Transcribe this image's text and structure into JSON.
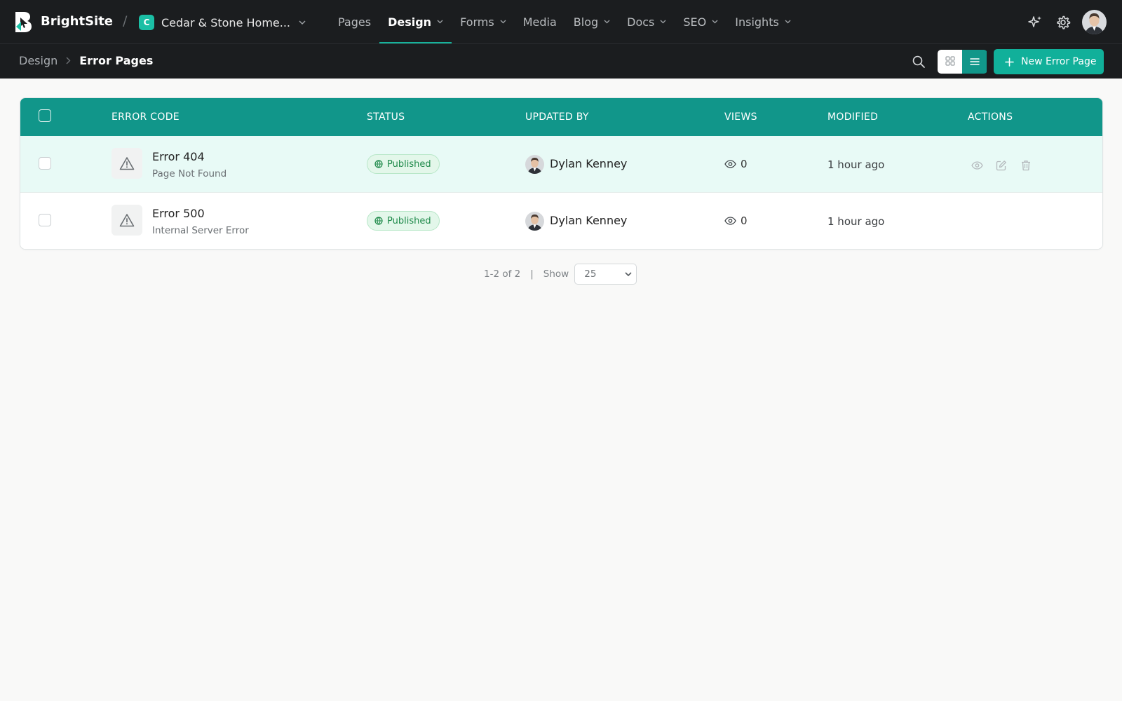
{
  "app": {
    "brand": "BrightSite",
    "slash": "/"
  },
  "site": {
    "badge": "C",
    "name": "Cedar & Stone Home..."
  },
  "nav": [
    {
      "label": "Pages",
      "has_menu": false,
      "active": false
    },
    {
      "label": "Design",
      "has_menu": true,
      "active": true
    },
    {
      "label": "Forms",
      "has_menu": true,
      "active": false
    },
    {
      "label": "Media",
      "has_menu": false,
      "active": false
    },
    {
      "label": "Blog",
      "has_menu": true,
      "active": false
    },
    {
      "label": "Docs",
      "has_menu": true,
      "active": false
    },
    {
      "label": "SEO",
      "has_menu": true,
      "active": false
    },
    {
      "label": "Insights",
      "has_menu": true,
      "active": false
    }
  ],
  "breadcrumb": {
    "parent": "Design",
    "current": "Error Pages"
  },
  "toolbar": {
    "new_button_label": "New Error Page",
    "view_mode": "list"
  },
  "table": {
    "headers": {
      "error_code": "ERROR CODE",
      "status": "STATUS",
      "updated_by": "UPDATED BY",
      "views": "VIEWS",
      "modified": "MODIFIED",
      "actions": "ACTIONS"
    },
    "rows": [
      {
        "title": "Error 404",
        "subtitle": "Page Not Found",
        "status": "Published",
        "updated_by": "Dylan Kenney",
        "views": "0",
        "modified": "1 hour ago",
        "hovered": true
      },
      {
        "title": "Error 500",
        "subtitle": "Internal Server Error",
        "status": "Published",
        "updated_by": "Dylan Kenney",
        "views": "0",
        "modified": "1 hour ago",
        "hovered": false
      }
    ]
  },
  "pagination": {
    "range": "1-2 of 2",
    "separator": "|",
    "show_label": "Show",
    "page_size": "25"
  },
  "colors": {
    "topbar_bg": "#1b1d1f",
    "accent": "#11b09a",
    "table_header": "#11968a",
    "hover_row": "#e8faf6",
    "published_text": "#1f8a4a",
    "published_bg": "#e3f7ea"
  },
  "icons": {
    "logo": "brightsite-logo",
    "ai": "sparkles-icon",
    "settings": "gear-icon",
    "search": "search-icon",
    "grid_view": "grid-icon",
    "list_view": "list-icon",
    "add": "plus-icon",
    "error": "warning-triangle-icon",
    "status": "globe-icon",
    "views": "eye-icon",
    "row_actions": [
      "eye-icon",
      "edit-icon",
      "trash-icon"
    ]
  }
}
